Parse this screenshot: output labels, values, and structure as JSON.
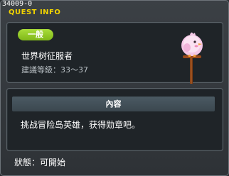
{
  "header": {
    "quest_id": "34009-0",
    "title": "QUEST INFO"
  },
  "quest": {
    "category_badge": "一般",
    "name": "世界树征服者",
    "level_requirement": "建議等級：33～37",
    "npc_icon": "pink-bird-npc-icon"
  },
  "content": {
    "header_label": "內容",
    "description": "挑战冒险岛英雄，获得勋章吧。"
  },
  "footer": {
    "status": "狀態：可開始"
  },
  "colors": {
    "title": "#f2d400",
    "badge": "#8dc425",
    "panel": "#1f2428",
    "window": "#34393e"
  }
}
